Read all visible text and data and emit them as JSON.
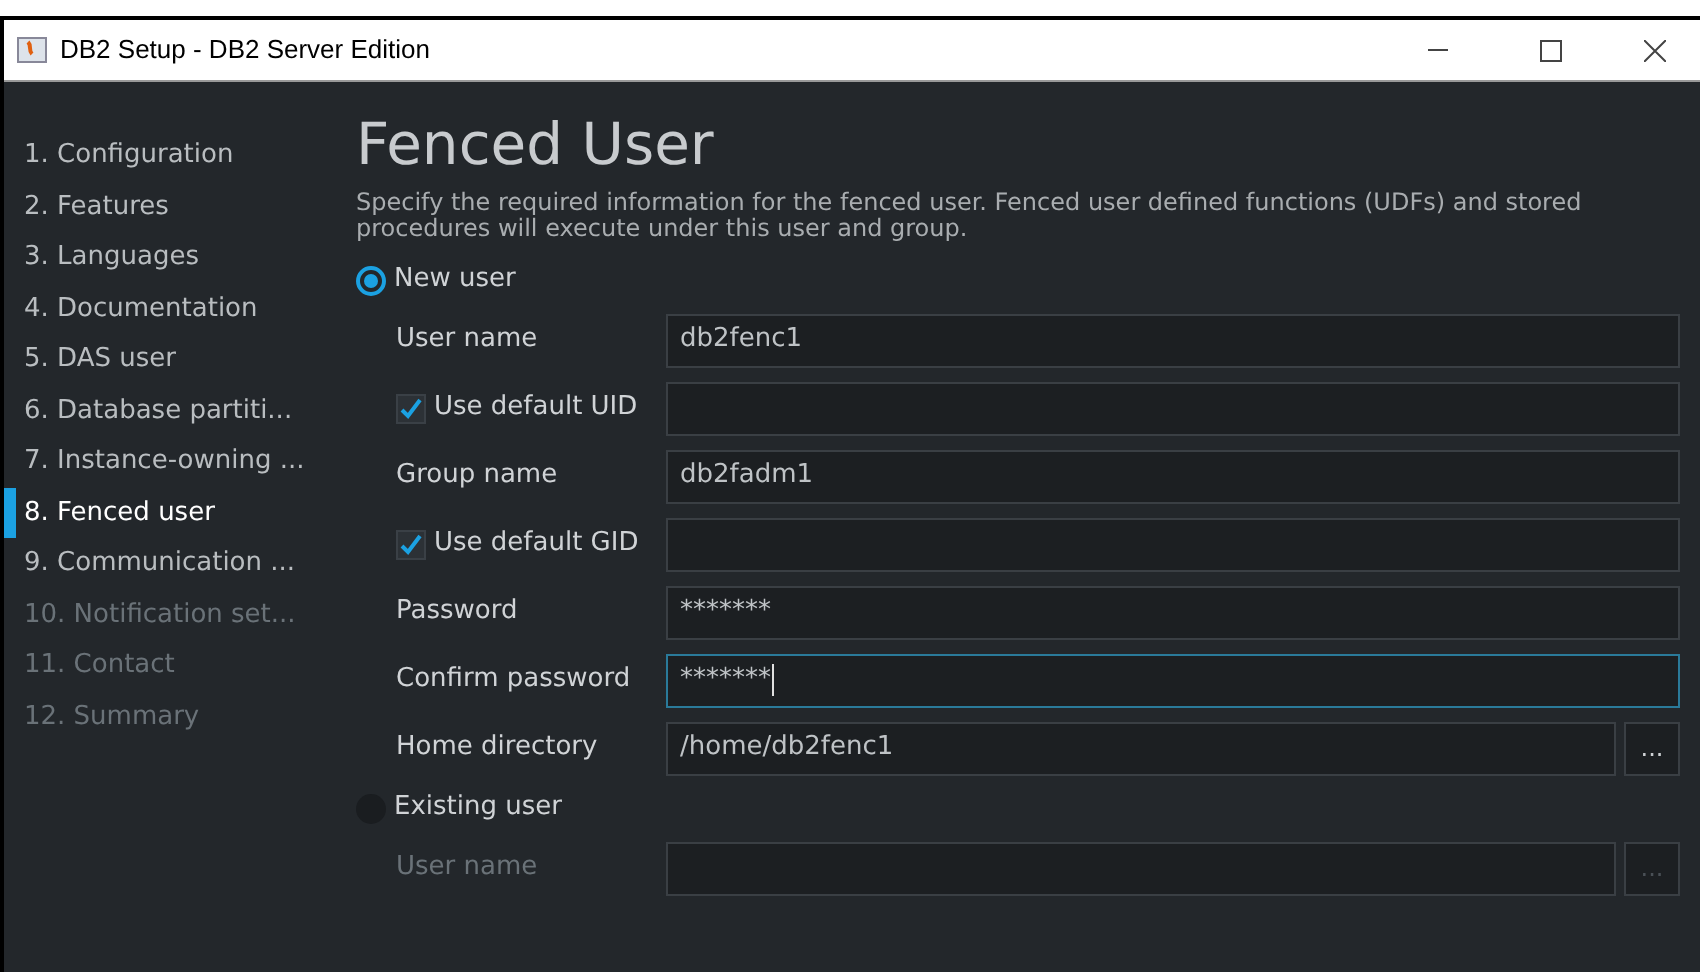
{
  "window": {
    "title": "DB2 Setup - DB2 Server Edition"
  },
  "steps": [
    {
      "label": "1. Configuration",
      "selected": false,
      "disabled": false
    },
    {
      "label": "2. Features",
      "selected": false,
      "disabled": false
    },
    {
      "label": "3. Languages",
      "selected": false,
      "disabled": false
    },
    {
      "label": "4. Documentation",
      "selected": false,
      "disabled": false
    },
    {
      "label": "5. DAS user",
      "selected": false,
      "disabled": false
    },
    {
      "label": "6. Database partiti...",
      "selected": false,
      "disabled": false
    },
    {
      "label": "7. Instance-owning ...",
      "selected": false,
      "disabled": false
    },
    {
      "label": "8. Fenced user",
      "selected": true,
      "disabled": false
    },
    {
      "label": "9. Communication ...",
      "selected": false,
      "disabled": false
    },
    {
      "label": "10. Notification set...",
      "selected": false,
      "disabled": true
    },
    {
      "label": "11. Contact",
      "selected": false,
      "disabled": true
    },
    {
      "label": "12. Summary",
      "selected": false,
      "disabled": true
    }
  ],
  "page": {
    "title": "Fenced User",
    "description": "Specify the required information for the fenced user.  Fenced user defined functions (UDFs) and stored procedures will execute under this user and group."
  },
  "new_user": {
    "label": "New user",
    "selected": true,
    "rows": [
      {
        "kind": "text",
        "label": "User name",
        "value": "db2fenc1",
        "focused": false
      },
      {
        "kind": "check",
        "label": "Use default UID",
        "checked": true,
        "value": "",
        "focused": false
      },
      {
        "kind": "text",
        "label": "Group name",
        "value": "db2fadm1",
        "focused": false
      },
      {
        "kind": "check",
        "label": "Use default GID",
        "checked": true,
        "value": "",
        "focused": false
      },
      {
        "kind": "text",
        "label": "Password",
        "value": "*******",
        "focused": false
      },
      {
        "kind": "text",
        "label": "Confirm password",
        "value": "*******",
        "focused": true
      },
      {
        "kind": "browse",
        "label": "Home directory",
        "value": "/home/db2fenc1",
        "focused": false,
        "button": "..."
      }
    ]
  },
  "existing_user": {
    "label": "Existing user",
    "selected": false,
    "rows": [
      {
        "kind": "browse",
        "label": "User name",
        "value": "",
        "focused": false,
        "button": "...",
        "disabled": true
      }
    ]
  }
}
